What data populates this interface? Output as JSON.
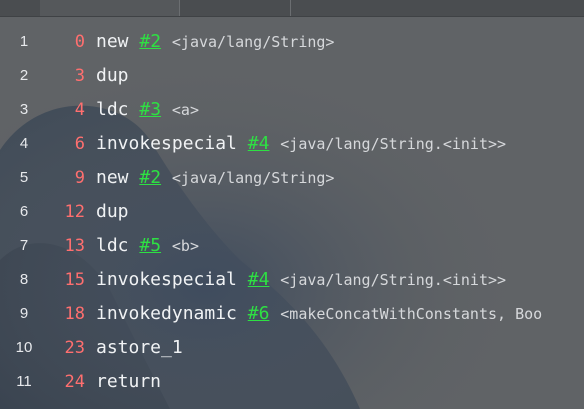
{
  "editor": {
    "lines": [
      {
        "num": "1",
        "offset": "0",
        "op": "new",
        "ref": "#2",
        "comment": "<java/lang/String>"
      },
      {
        "num": "2",
        "offset": "3",
        "op": "dup",
        "ref": "",
        "comment": ""
      },
      {
        "num": "3",
        "offset": "4",
        "op": "ldc",
        "ref": "#3",
        "comment": "<a>"
      },
      {
        "num": "4",
        "offset": "6",
        "op": "invokespecial",
        "ref": "#4",
        "comment": "<java/lang/String.<init>>"
      },
      {
        "num": "5",
        "offset": "9",
        "op": "new",
        "ref": "#2",
        "comment": "<java/lang/String>"
      },
      {
        "num": "6",
        "offset": "12",
        "op": "dup",
        "ref": "",
        "comment": ""
      },
      {
        "num": "7",
        "offset": "13",
        "op": "ldc",
        "ref": "#5",
        "comment": "<b>"
      },
      {
        "num": "8",
        "offset": "15",
        "op": "invokespecial",
        "ref": "#4",
        "comment": "<java/lang/String.<init>>"
      },
      {
        "num": "9",
        "offset": "18",
        "op": "invokedynamic",
        "ref": "#6",
        "comment": "<makeConcatWithConstants, Boo"
      },
      {
        "num": "10",
        "offset": "23",
        "op": "astore_1",
        "ref": "",
        "comment": ""
      },
      {
        "num": "11",
        "offset": "24",
        "op": "return",
        "ref": "",
        "comment": ""
      }
    ]
  },
  "colors": {
    "line_number": "#e7e9ec",
    "offset": "#ff6f6f",
    "opcode": "#f0f2f4",
    "reference": "#2ee043",
    "comment": "#d6d8db",
    "background": "#5d6063"
  }
}
